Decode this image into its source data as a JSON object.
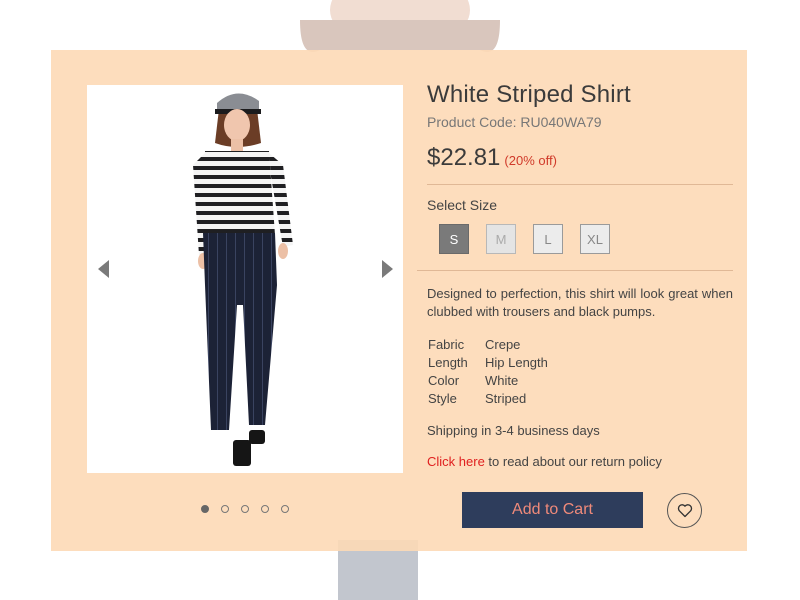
{
  "product": {
    "title": "White Striped Shirt",
    "code": "Product Code: RU040WA79",
    "price": "$22.81",
    "discount": "(20% off)"
  },
  "size_select": {
    "label": "Select Size",
    "options": [
      {
        "label": "S",
        "state": "selected"
      },
      {
        "label": "M",
        "state": "disabled"
      },
      {
        "label": "L",
        "state": "available"
      },
      {
        "label": "XL",
        "state": "available"
      }
    ]
  },
  "description": "Designed to perfection, this shirt will look great when clubbed with trousers and black pumps.",
  "specs": [
    {
      "key": "Fabric",
      "value": "Crepe"
    },
    {
      "key": "Length",
      "value": "Hip Length"
    },
    {
      "key": "Color",
      "value": "White"
    },
    {
      "key": "Style",
      "value": "Striped"
    }
  ],
  "shipping": "Shipping in 3-4 business days",
  "policy": {
    "link_text": "Click here",
    "rest_text": " to read about our return policy"
  },
  "actions": {
    "add_to_cart": "Add to Cart",
    "wishlist_icon": "heart-icon"
  },
  "gallery": {
    "slide_count": 5,
    "active_index": 0,
    "prev_icon": "chevron-left-icon",
    "next_icon": "chevron-right-icon"
  },
  "colors": {
    "card_bg": "#fdd9b6",
    "cart_button_bg": "#2e3d5c",
    "cart_button_text": "#f08a7a",
    "discount": "#d03a2a",
    "link": "#e02020"
  }
}
